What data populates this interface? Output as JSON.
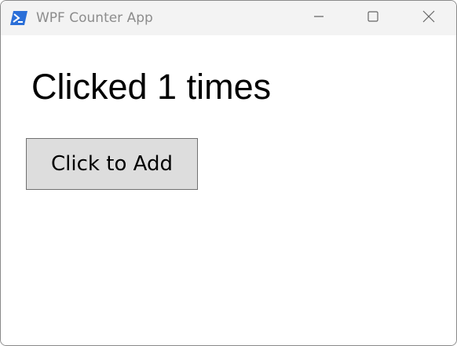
{
  "window": {
    "title": "WPF Counter App",
    "icon": "powershell-icon",
    "controls": {
      "minimize_icon": "minimize-icon",
      "maximize_icon": "maximize-icon",
      "close_icon": "close-icon"
    }
  },
  "main": {
    "counter_text": "Clicked 1 times",
    "add_button_label": "Click to Add"
  },
  "colors": {
    "titlebar_bg": "#f3f3f3",
    "title_text": "#8c8c8c",
    "button_bg": "#dddddd",
    "button_border": "#707070",
    "icon_blue": "#2b6fd8"
  }
}
